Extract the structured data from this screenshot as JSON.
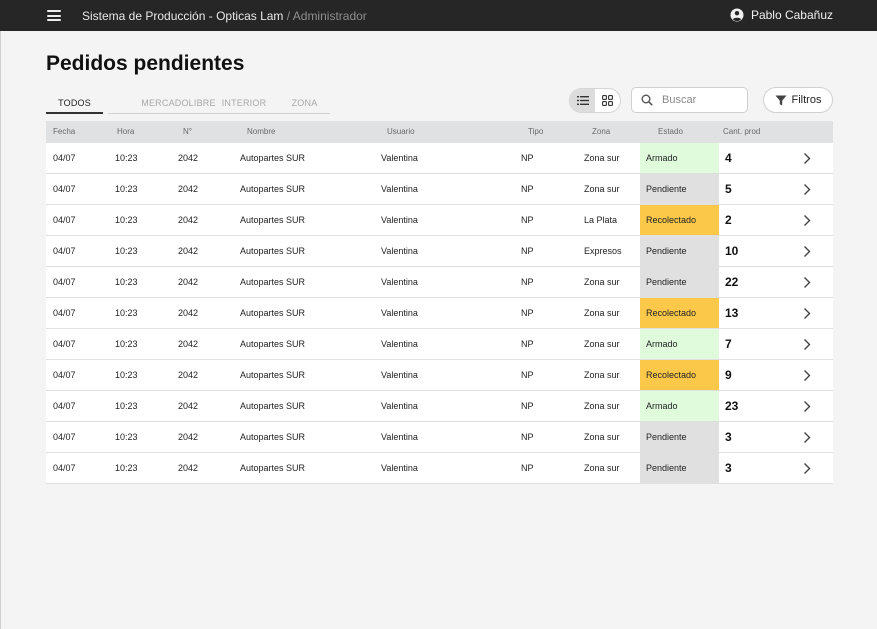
{
  "topbar": {
    "app_title": "Sistema de Producción - Opticas Lam",
    "role": " / Administrador",
    "user_name": "Pablo Cabañuz"
  },
  "page": {
    "title": "Pedidos pendientes"
  },
  "tabs": [
    {
      "label": "TODOS",
      "active": true
    },
    {
      "label": "MERCADOLIBRE",
      "active": false
    },
    {
      "label": "INTERIOR",
      "active": false
    },
    {
      "label": "ZONA",
      "active": false
    }
  ],
  "view_toggle": {
    "selected": "list"
  },
  "search": {
    "placeholder": "Buscar",
    "value": ""
  },
  "filters": {
    "label": "Filtros"
  },
  "table": {
    "headers": {
      "fecha": "Fecha",
      "hora": "Hora",
      "numero": "N°",
      "nombre": "Nombre",
      "usuario": "Usuario",
      "tipo": "Tipo",
      "zona": "Zona",
      "estado": "Estado",
      "cant": "Cant. prod"
    },
    "rows": [
      {
        "fecha": "04/07",
        "hora": "10:23",
        "numero": "2042",
        "nombre": "Autopartes SUR",
        "usuario": "Valentina",
        "tipo": "NP",
        "zona": "Zona sur",
        "estado": "Armado",
        "cant": "4"
      },
      {
        "fecha": "04/07",
        "hora": "10:23",
        "numero": "2042",
        "nombre": "Autopartes SUR",
        "usuario": "Valentina",
        "tipo": "NP",
        "zona": "Zona sur",
        "estado": "Pendiente",
        "cant": "5"
      },
      {
        "fecha": "04/07",
        "hora": "10:23",
        "numero": "2042",
        "nombre": "Autopartes SUR",
        "usuario": "Valentina",
        "tipo": "NP",
        "zona": "La Plata",
        "estado": "Recolectado",
        "cant": "2"
      },
      {
        "fecha": "04/07",
        "hora": "10:23",
        "numero": "2042",
        "nombre": "Autopartes SUR",
        "usuario": "Valentina",
        "tipo": "NP",
        "zona": "Expresos",
        "estado": "Pendiente",
        "cant": "10"
      },
      {
        "fecha": "04/07",
        "hora": "10:23",
        "numero": "2042",
        "nombre": "Autopartes SUR",
        "usuario": "Valentina",
        "tipo": "NP",
        "zona": "Zona sur",
        "estado": "Pendiente",
        "cant": "22"
      },
      {
        "fecha": "04/07",
        "hora": "10:23",
        "numero": "2042",
        "nombre": "Autopartes SUR",
        "usuario": "Valentina",
        "tipo": "NP",
        "zona": "Zona sur",
        "estado": "Recolectado",
        "cant": "13"
      },
      {
        "fecha": "04/07",
        "hora": "10:23",
        "numero": "2042",
        "nombre": "Autopartes SUR",
        "usuario": "Valentina",
        "tipo": "NP",
        "zona": "Zona sur",
        "estado": "Armado",
        "cant": "7"
      },
      {
        "fecha": "04/07",
        "hora": "10:23",
        "numero": "2042",
        "nombre": "Autopartes SUR",
        "usuario": "Valentina",
        "tipo": "NP",
        "zona": "Zona sur",
        "estado": "Recolectado",
        "cant": "9"
      },
      {
        "fecha": "04/07",
        "hora": "10:23",
        "numero": "2042",
        "nombre": "Autopartes SUR",
        "usuario": "Valentina",
        "tipo": "NP",
        "zona": "Zona sur",
        "estado": "Armado",
        "cant": "23"
      },
      {
        "fecha": "04/07",
        "hora": "10:23",
        "numero": "2042",
        "nombre": "Autopartes SUR",
        "usuario": "Valentina",
        "tipo": "NP",
        "zona": "Zona sur",
        "estado": "Pendiente",
        "cant": "3"
      },
      {
        "fecha": "04/07",
        "hora": "10:23",
        "numero": "2042",
        "nombre": "Autopartes SUR",
        "usuario": "Valentina",
        "tipo": "NP",
        "zona": "Zona sur",
        "estado": "Pendiente",
        "cant": "3"
      }
    ]
  },
  "colors": {
    "topbar_bg": "#262626",
    "estado_armado": "#dffbdc",
    "estado_pendiente": "#e0e0e0",
    "estado_recolectado": "#fcc84a"
  },
  "icons": {
    "menu": "hamburger-menu-icon",
    "user": "account-circle-icon",
    "list_view": "list-view-icon",
    "grid_view": "grid-view-icon",
    "search": "search-icon",
    "filter": "filter-icon",
    "row_action": "chevron-right-icon"
  }
}
